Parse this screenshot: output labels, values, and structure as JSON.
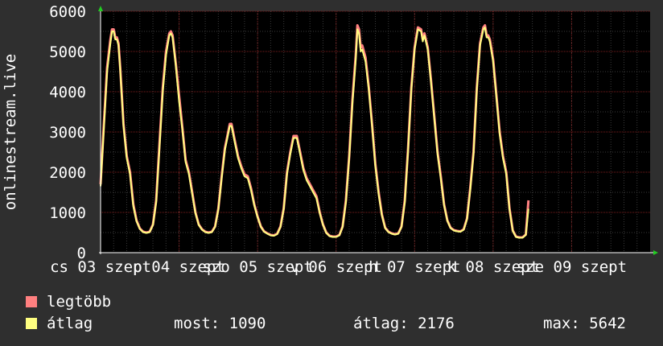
{
  "chart_data": {
    "type": "line",
    "ylabel": "onlinestream.live",
    "ylim": [
      0,
      6000
    ],
    "yticks": [
      0,
      1000,
      2000,
      3000,
      4000,
      5000,
      6000
    ],
    "xlim": [
      0,
      7
    ],
    "xticks": [
      {
        "x": 0,
        "label": "cs 03 szept"
      },
      {
        "x": 1,
        "label": "p 04 szept"
      },
      {
        "x": 2,
        "label": "szo 05 szept"
      },
      {
        "x": 3,
        "label": "v 06 szept"
      },
      {
        "x": 4,
        "label": "h 07 szept"
      },
      {
        "x": 5,
        "label": "k 08 szept"
      },
      {
        "x": 6,
        "label": "sze 09 szept"
      }
    ],
    "grid": true,
    "legend_position": "bottom-left",
    "series": [
      {
        "name": "legtöbb",
        "color": "#ff8080",
        "points": [
          [
            0.0,
            1700
          ],
          [
            0.042,
            3200
          ],
          [
            0.083,
            4600
          ],
          [
            0.125,
            5300
          ],
          [
            0.146,
            5550
          ],
          [
            0.167,
            5550
          ],
          [
            0.188,
            5350
          ],
          [
            0.208,
            5350
          ],
          [
            0.229,
            5200
          ],
          [
            0.25,
            4600
          ],
          [
            0.292,
            3200
          ],
          [
            0.333,
            2400
          ],
          [
            0.375,
            2000
          ],
          [
            0.417,
            1200
          ],
          [
            0.458,
            800
          ],
          [
            0.5,
            600
          ],
          [
            0.542,
            520
          ],
          [
            0.583,
            500
          ],
          [
            0.625,
            520
          ],
          [
            0.667,
            700
          ],
          [
            0.708,
            1300
          ],
          [
            0.75,
            2700
          ],
          [
            0.792,
            4100
          ],
          [
            0.833,
            5000
          ],
          [
            0.875,
            5450
          ],
          [
            0.896,
            5500
          ],
          [
            0.917,
            5400
          ],
          [
            0.958,
            4700
          ],
          [
            1.0,
            3900
          ],
          [
            1.042,
            3100
          ],
          [
            1.083,
            2300
          ],
          [
            1.125,
            2000
          ],
          [
            1.167,
            1500
          ],
          [
            1.208,
            1000
          ],
          [
            1.25,
            700
          ],
          [
            1.292,
            580
          ],
          [
            1.333,
            520
          ],
          [
            1.375,
            500
          ],
          [
            1.417,
            520
          ],
          [
            1.458,
            650
          ],
          [
            1.5,
            1100
          ],
          [
            1.542,
            1900
          ],
          [
            1.583,
            2600
          ],
          [
            1.625,
            3000
          ],
          [
            1.646,
            3200
          ],
          [
            1.667,
            3200
          ],
          [
            1.708,
            2800
          ],
          [
            1.75,
            2400
          ],
          [
            1.792,
            2150
          ],
          [
            1.833,
            1950
          ],
          [
            1.875,
            1900
          ],
          [
            1.917,
            1600
          ],
          [
            1.958,
            1200
          ],
          [
            2.0,
            900
          ],
          [
            2.042,
            650
          ],
          [
            2.083,
            530
          ],
          [
            2.125,
            480
          ],
          [
            2.167,
            440
          ],
          [
            2.208,
            430
          ],
          [
            2.25,
            470
          ],
          [
            2.292,
            650
          ],
          [
            2.333,
            1100
          ],
          [
            2.375,
            2000
          ],
          [
            2.417,
            2500
          ],
          [
            2.458,
            2900
          ],
          [
            2.5,
            2900
          ],
          [
            2.542,
            2500
          ],
          [
            2.583,
            2100
          ],
          [
            2.625,
            1850
          ],
          [
            2.667,
            1700
          ],
          [
            2.708,
            1550
          ],
          [
            2.75,
            1400
          ],
          [
            2.792,
            1000
          ],
          [
            2.833,
            700
          ],
          [
            2.875,
            500
          ],
          [
            2.917,
            420
          ],
          [
            2.958,
            400
          ],
          [
            3.0,
            400
          ],
          [
            3.042,
            440
          ],
          [
            3.083,
            650
          ],
          [
            3.125,
            1300
          ],
          [
            3.167,
            2400
          ],
          [
            3.208,
            3800
          ],
          [
            3.25,
            4900
          ],
          [
            3.271,
            5650
          ],
          [
            3.292,
            5550
          ],
          [
            3.313,
            5100
          ],
          [
            3.333,
            5150
          ],
          [
            3.375,
            4850
          ],
          [
            3.417,
            4100
          ],
          [
            3.458,
            3200
          ],
          [
            3.5,
            2200
          ],
          [
            3.542,
            1500
          ],
          [
            3.583,
            950
          ],
          [
            3.625,
            620
          ],
          [
            3.667,
            520
          ],
          [
            3.708,
            480
          ],
          [
            3.75,
            460
          ],
          [
            3.792,
            480
          ],
          [
            3.833,
            650
          ],
          [
            3.875,
            1300
          ],
          [
            3.917,
            2600
          ],
          [
            3.958,
            4100
          ],
          [
            4.0,
            5100
          ],
          [
            4.042,
            5600
          ],
          [
            4.083,
            5550
          ],
          [
            4.104,
            5300
          ],
          [
            4.125,
            5450
          ],
          [
            4.167,
            5100
          ],
          [
            4.208,
            4300
          ],
          [
            4.25,
            3400
          ],
          [
            4.292,
            2500
          ],
          [
            4.333,
            1900
          ],
          [
            4.375,
            1200
          ],
          [
            4.417,
            800
          ],
          [
            4.458,
            620
          ],
          [
            4.5,
            560
          ],
          [
            4.542,
            540
          ],
          [
            4.583,
            530
          ],
          [
            4.625,
            580
          ],
          [
            4.667,
            850
          ],
          [
            4.708,
            1600
          ],
          [
            4.75,
            2500
          ],
          [
            4.792,
            4100
          ],
          [
            4.833,
            5200
          ],
          [
            4.875,
            5600
          ],
          [
            4.896,
            5650
          ],
          [
            4.917,
            5400
          ],
          [
            4.938,
            5400
          ],
          [
            4.958,
            5300
          ],
          [
            5.0,
            4800
          ],
          [
            5.042,
            3900
          ],
          [
            5.083,
            3000
          ],
          [
            5.125,
            2400
          ],
          [
            5.167,
            2000
          ],
          [
            5.208,
            1100
          ],
          [
            5.25,
            550
          ],
          [
            5.292,
            400
          ],
          [
            5.333,
            380
          ],
          [
            5.375,
            380
          ],
          [
            5.417,
            450
          ],
          [
            5.45,
            1300
          ]
        ]
      },
      {
        "name": "átlag",
        "color": "#ffff80",
        "points": [
          [
            0.0,
            1650
          ],
          [
            0.042,
            3100
          ],
          [
            0.083,
            4500
          ],
          [
            0.125,
            5200
          ],
          [
            0.146,
            5500
          ],
          [
            0.167,
            5500
          ],
          [
            0.188,
            5300
          ],
          [
            0.208,
            5300
          ],
          [
            0.229,
            5150
          ],
          [
            0.25,
            4550
          ],
          [
            0.292,
            3150
          ],
          [
            0.333,
            2350
          ],
          [
            0.375,
            1950
          ],
          [
            0.417,
            1150
          ],
          [
            0.458,
            780
          ],
          [
            0.5,
            590
          ],
          [
            0.542,
            510
          ],
          [
            0.583,
            490
          ],
          [
            0.625,
            510
          ],
          [
            0.667,
            690
          ],
          [
            0.708,
            1250
          ],
          [
            0.75,
            2600
          ],
          [
            0.792,
            4000
          ],
          [
            0.833,
            4900
          ],
          [
            0.875,
            5400
          ],
          [
            0.896,
            5450
          ],
          [
            0.917,
            5350
          ],
          [
            0.958,
            4650
          ],
          [
            1.0,
            3750
          ],
          [
            1.042,
            3050
          ],
          [
            1.083,
            2250
          ],
          [
            1.125,
            1950
          ],
          [
            1.167,
            1450
          ],
          [
            1.208,
            980
          ],
          [
            1.25,
            690
          ],
          [
            1.292,
            570
          ],
          [
            1.333,
            510
          ],
          [
            1.375,
            490
          ],
          [
            1.417,
            510
          ],
          [
            1.458,
            640
          ],
          [
            1.5,
            1080
          ],
          [
            1.542,
            1850
          ],
          [
            1.583,
            2550
          ],
          [
            1.625,
            2950
          ],
          [
            1.646,
            3150
          ],
          [
            1.667,
            3150
          ],
          [
            1.708,
            2750
          ],
          [
            1.75,
            2350
          ],
          [
            1.792,
            2100
          ],
          [
            1.833,
            1900
          ],
          [
            1.875,
            1850
          ],
          [
            1.917,
            1550
          ],
          [
            1.958,
            1180
          ],
          [
            2.0,
            880
          ],
          [
            2.042,
            640
          ],
          [
            2.083,
            520
          ],
          [
            2.125,
            470
          ],
          [
            2.167,
            430
          ],
          [
            2.208,
            420
          ],
          [
            2.25,
            460
          ],
          [
            2.292,
            640
          ],
          [
            2.333,
            1080
          ],
          [
            2.375,
            1950
          ],
          [
            2.417,
            2450
          ],
          [
            2.458,
            2850
          ],
          [
            2.5,
            2850
          ],
          [
            2.542,
            2450
          ],
          [
            2.583,
            2050
          ],
          [
            2.625,
            1800
          ],
          [
            2.667,
            1650
          ],
          [
            2.708,
            1500
          ],
          [
            2.75,
            1350
          ],
          [
            2.792,
            980
          ],
          [
            2.833,
            690
          ],
          [
            2.875,
            490
          ],
          [
            2.917,
            410
          ],
          [
            2.958,
            390
          ],
          [
            3.0,
            390
          ],
          [
            3.042,
            430
          ],
          [
            3.083,
            640
          ],
          [
            3.125,
            1250
          ],
          [
            3.167,
            2350
          ],
          [
            3.208,
            3700
          ],
          [
            3.25,
            4800
          ],
          [
            3.271,
            5550
          ],
          [
            3.292,
            5450
          ],
          [
            3.313,
            5000
          ],
          [
            3.333,
            5050
          ],
          [
            3.375,
            4750
          ],
          [
            3.417,
            4050
          ],
          [
            3.458,
            3150
          ],
          [
            3.5,
            2150
          ],
          [
            3.542,
            1450
          ],
          [
            3.583,
            930
          ],
          [
            3.625,
            610
          ],
          [
            3.667,
            510
          ],
          [
            3.708,
            470
          ],
          [
            3.75,
            450
          ],
          [
            3.792,
            470
          ],
          [
            3.833,
            640
          ],
          [
            3.875,
            1250
          ],
          [
            3.917,
            2550
          ],
          [
            3.958,
            4050
          ],
          [
            4.0,
            5050
          ],
          [
            4.042,
            5550
          ],
          [
            4.083,
            5500
          ],
          [
            4.104,
            5250
          ],
          [
            4.125,
            5400
          ],
          [
            4.167,
            5050
          ],
          [
            4.208,
            4250
          ],
          [
            4.25,
            3350
          ],
          [
            4.292,
            2450
          ],
          [
            4.333,
            1850
          ],
          [
            4.375,
            1180
          ],
          [
            4.417,
            790
          ],
          [
            4.458,
            610
          ],
          [
            4.5,
            550
          ],
          [
            4.542,
            530
          ],
          [
            4.583,
            520
          ],
          [
            4.625,
            570
          ],
          [
            4.667,
            830
          ],
          [
            4.708,
            1550
          ],
          [
            4.75,
            2450
          ],
          [
            4.792,
            4050
          ],
          [
            4.833,
            5150
          ],
          [
            4.875,
            5550
          ],
          [
            4.896,
            5600
          ],
          [
            4.917,
            5350
          ],
          [
            4.938,
            5350
          ],
          [
            4.958,
            5250
          ],
          [
            5.0,
            4750
          ],
          [
            5.042,
            3850
          ],
          [
            5.083,
            2950
          ],
          [
            5.125,
            2350
          ],
          [
            5.167,
            1950
          ],
          [
            5.208,
            1080
          ],
          [
            5.25,
            540
          ],
          [
            5.292,
            390
          ],
          [
            5.333,
            370
          ],
          [
            5.375,
            370
          ],
          [
            5.417,
            440
          ],
          [
            5.45,
            1090
          ]
        ]
      }
    ]
  },
  "legend": {
    "items": [
      {
        "label": "legtöbb",
        "color": "#ff8080"
      },
      {
        "label": "átlag",
        "color": "#ffff80"
      }
    ]
  },
  "stats": {
    "now": "most: 1090",
    "avg": "átlag: 2176",
    "max": "max: 5642"
  }
}
